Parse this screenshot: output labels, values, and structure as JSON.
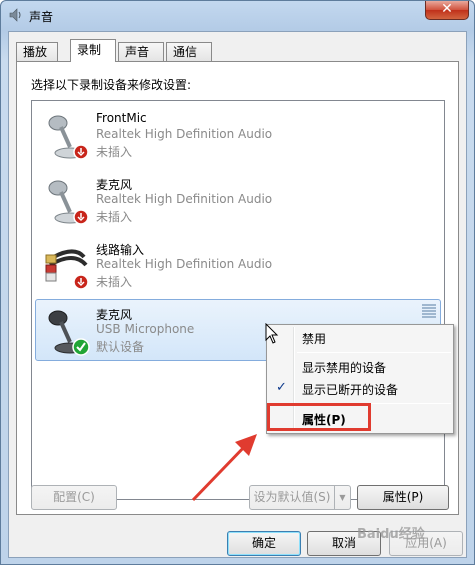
{
  "window": {
    "title": "声音",
    "close_label": "✕"
  },
  "tabs": [
    {
      "label": "播放",
      "active": false
    },
    {
      "label": "录制",
      "active": true
    },
    {
      "label": "声音",
      "active": false
    },
    {
      "label": "通信",
      "active": false
    }
  ],
  "instruction": "选择以下录制设备来修改设置:",
  "devices": [
    {
      "name": "FrontMic",
      "description": "Realtek High Definition Audio",
      "status": "未插入",
      "icon": "microphone-icon",
      "badge": "unplugged"
    },
    {
      "name": "麦克风",
      "description": "Realtek High Definition Audio",
      "status": "未插入",
      "icon": "microphone-icon",
      "badge": "unplugged"
    },
    {
      "name": "线路输入",
      "description": "Realtek High Definition Audio",
      "status": "未插入",
      "icon": "line-in-cable-icon",
      "badge": "unplugged"
    },
    {
      "name": "麦克风",
      "description": "USB Microphone",
      "status": "默认设备",
      "icon": "microphone-icon",
      "badge": "default-check",
      "selected": true
    }
  ],
  "context_menu": {
    "items": [
      {
        "label": "禁用"
      },
      {
        "label": "显示禁用的设备"
      },
      {
        "label": "显示已断开的设备",
        "checked": true
      },
      {
        "label": "属性(P)",
        "highlighted": true
      }
    ]
  },
  "buttons": {
    "configure": "配置(C)",
    "set_default": "设为默认值(S)",
    "properties": "属性(P)",
    "ok": "确定",
    "cancel": "取消",
    "apply": "应用(A)"
  },
  "watermark": "Baidu经验",
  "colors": {
    "annotation_red": "#e03b2f",
    "selection_blue": "#d3e6f9",
    "unplugged_red": "#c8251b",
    "default_green": "#21a536"
  }
}
